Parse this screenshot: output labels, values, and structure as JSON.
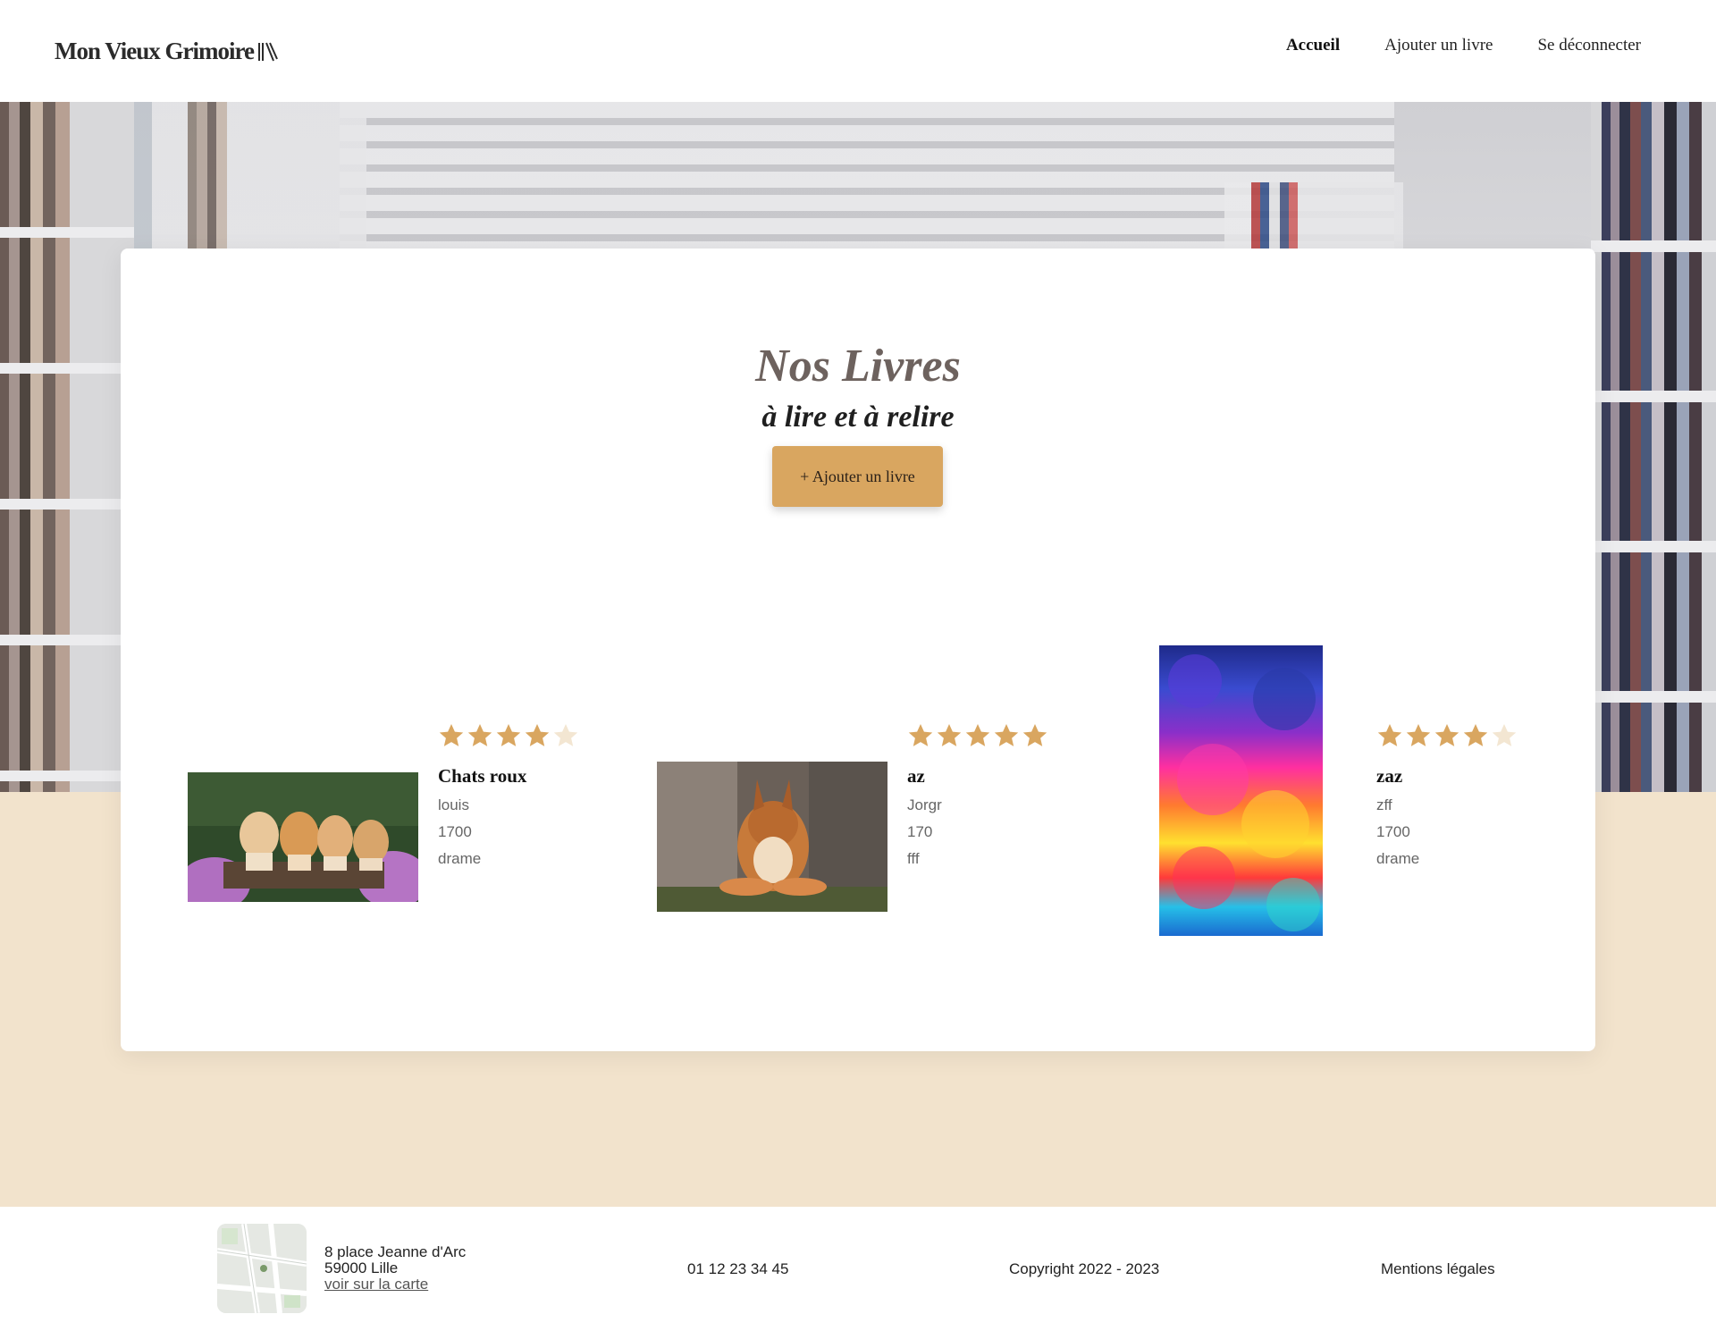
{
  "header": {
    "logo": "Mon Vieux Grimoire",
    "nav": [
      {
        "label": "Accueil",
        "active": true
      },
      {
        "label": "Ajouter un livre",
        "active": false
      },
      {
        "label": "Se déconnecter",
        "active": false
      }
    ]
  },
  "main": {
    "title": "Nos Livres",
    "subtitle": "à lire et à relire",
    "add_button": "+ Ajouter un livre",
    "books": [
      {
        "title": "Chats roux",
        "author": "louis",
        "year": "1700",
        "genre": "drame",
        "rating": 4,
        "max_rating": 5,
        "image": "kittens-photo"
      },
      {
        "title": "az",
        "author": "Jorgr",
        "year": "170",
        "genre": "fff",
        "rating": 5,
        "max_rating": 5,
        "image": "squirrel-photo"
      },
      {
        "title": "zaz",
        "author": "zff",
        "year": "1700",
        "genre": "drame",
        "rating": 4,
        "max_rating": 5,
        "image": "colorful-clouds-art"
      }
    ]
  },
  "footer": {
    "address_line1": "8 place Jeanne d'Arc",
    "address_line2": "59000 Lille",
    "map_link": "voir sur la carte",
    "phone": "01 12 23 34 45",
    "copyright": "Copyright 2022 - 2023",
    "legal": "Mentions légales"
  },
  "colors": {
    "accent": "#d9a660",
    "star_filled": "#d9a660",
    "star_empty": "#f3e6d2",
    "page_bg": "#f2e3cc"
  }
}
